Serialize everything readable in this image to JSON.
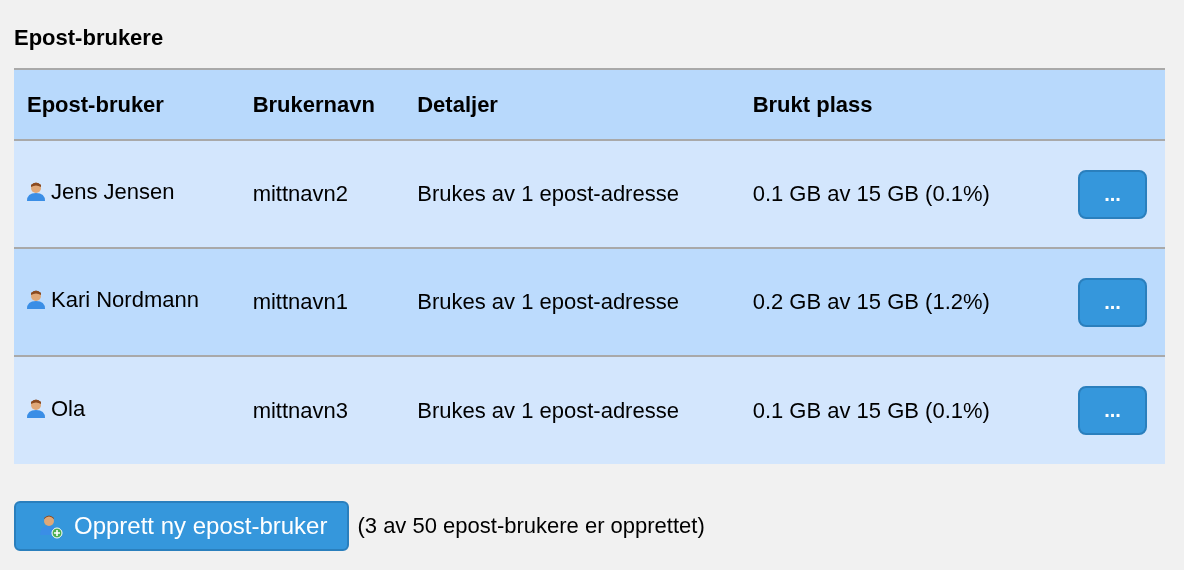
{
  "title": "Epost-brukere",
  "table": {
    "columns": [
      "Epost-bruker",
      "Brukernavn",
      "Detaljer",
      "Brukt plass"
    ],
    "rows": [
      {
        "name": "Jens Jensen",
        "username": "mittnavn2",
        "details": "Brukes av 1 epost-adresse",
        "usage": "0.1 GB av 15 GB (0.1%)",
        "action": "..."
      },
      {
        "name": "Kari Nordmann",
        "username": "mittnavn1",
        "details": "Brukes av 1 epost-adresse",
        "usage": "0.2 GB av 15 GB (1.2%)",
        "action": "..."
      },
      {
        "name": "Ola",
        "username": "mittnavn3",
        "details": "Brukes av 1 epost-adresse",
        "usage": "0.1 GB av 15 GB (0.1%)",
        "action": "..."
      }
    ]
  },
  "create_button": "Opprett ny epost-bruker",
  "count_note": "(3 av 50 epost-brukere er opprettet)"
}
